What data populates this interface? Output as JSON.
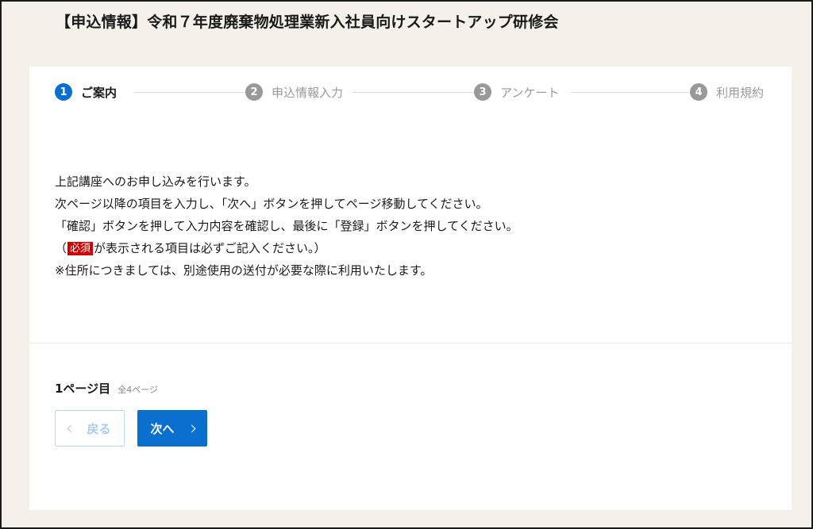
{
  "page": {
    "title": "【申込情報】令和７年度廃棄物処理業新入社員向けスタートアップ研修会"
  },
  "stepper": {
    "steps": [
      {
        "number": "1",
        "label": "ご案内",
        "state": "active"
      },
      {
        "number": "2",
        "label": "申込情報入力",
        "state": "inactive"
      },
      {
        "number": "3",
        "label": "アンケート",
        "state": "inactive"
      },
      {
        "number": "4",
        "label": "利用規約",
        "state": "inactive"
      }
    ]
  },
  "intro": {
    "line1": "上記講座へのお申し込みを行います。",
    "line2": "次ページ以降の項目を入力し、「次へ」ボタンを押してページ移動してください。",
    "line3": "「確認」ボタンを押して入力内容を確認し、最後に「登録」ボタンを押してください。",
    "line4_open": "（",
    "line4_badge": "必須",
    "line4_rest": "が表示される項目は必ずご記入ください。）",
    "line5": "※住所につきましては、別途使用の送付が必要な際に利用いたします。"
  },
  "pagination": {
    "current_label": "1ページ目",
    "total_label": "全4ページ"
  },
  "buttons": {
    "back_label": "戻る",
    "next_label": "次へ"
  },
  "colors": {
    "accent": "#0b6fd0",
    "required_badge": "#d20000",
    "background": "#f5f0ea",
    "inactive_step": "#999999"
  },
  "icons": {
    "back": "chevron-left-icon",
    "next": "chevron-right-icon"
  }
}
